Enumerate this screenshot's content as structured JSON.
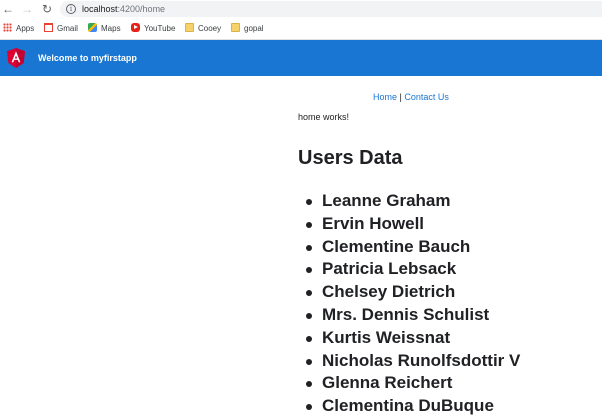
{
  "browser": {
    "url_host": "localhost",
    "url_path": ":4200/home",
    "bookmarks": [
      {
        "label": "Apps",
        "icon": "apps-grid-icon"
      },
      {
        "label": "Gmail",
        "icon": "gmail-icon"
      },
      {
        "label": "Maps",
        "icon": "maps-icon"
      },
      {
        "label": "YouTube",
        "icon": "youtube-icon"
      },
      {
        "label": "Cooey",
        "icon": "folder-icon"
      },
      {
        "label": "gopal",
        "icon": "folder-icon"
      }
    ]
  },
  "header": {
    "title": "Welcome to myfirstapp",
    "background": "#1976d2",
    "logo": "angular-logo-icon"
  },
  "nav": {
    "home_label": "Home",
    "separator": "|",
    "contact_label": "Contact Us"
  },
  "main": {
    "home_text": "home works!",
    "users_title": "Users Data",
    "users": [
      "Leanne Graham",
      "Ervin Howell",
      "Clementine Bauch",
      "Patricia Lebsack",
      "Chelsey Dietrich",
      "Mrs. Dennis Schulist",
      "Kurtis Weissnat",
      "Nicholas Runolfsdottir V",
      "Glenna Reichert",
      "Clementina DuBuque"
    ]
  }
}
